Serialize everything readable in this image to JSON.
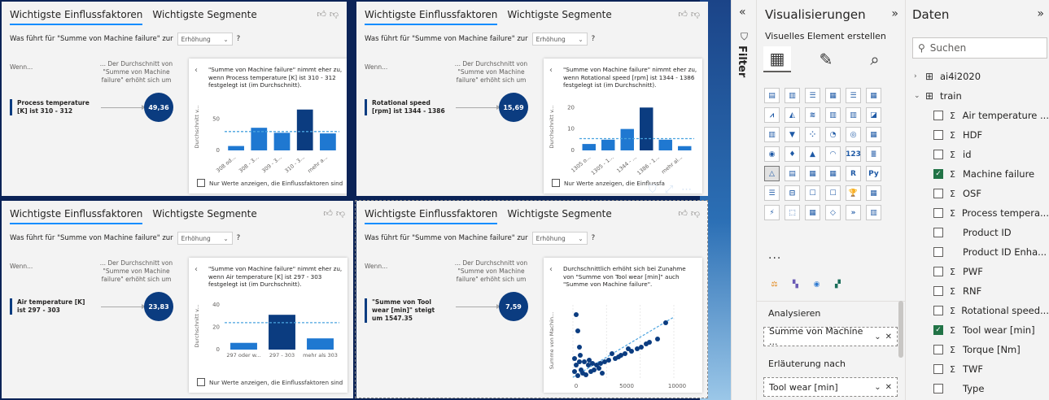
{
  "visuals": [
    {
      "tab_active": "Wichtigste Einflussfaktoren",
      "tab_other": "Wichtigste Segmente",
      "question_prefix": "Was führt für \"Summe von Machine failure\" zur",
      "select_value": "Erhöhung",
      "question_mark": "?",
      "wenn": "Wenn...",
      "avg_text": "... Der Durchschnitt von \"Summe von Machine failure\" erhöht sich um",
      "factor": "Process temperature [K] ist 310 - 312",
      "value": "49,36",
      "card_text": "\"Summe von Machine failure\" nimmt eher zu, wenn Process temperature [K] ist 310 - 312 festgelegt ist (im Durchschnitt).",
      "checkbox": "Nur Werte anzeigen, die Einflussfaktoren sind",
      "chart": {
        "ylabel": "Durchschnitt v...",
        "yticks": [
          "0",
          "50"
        ],
        "categories": [
          "308 od...",
          "308 - 3...",
          "309 - 3...",
          "310 - 3...",
          "mehr a..."
        ],
        "values": [
          7,
          36,
          28,
          65,
          27
        ],
        "highlight": 3,
        "avg": 30,
        "ymax": 75
      }
    },
    {
      "tab_active": "Wichtigste Einflussfaktoren",
      "tab_other": "Wichtigste Segmente",
      "question_prefix": "Was führt für \"Summe von Machine failure\" zur",
      "select_value": "Erhöhung",
      "question_mark": "?",
      "wenn": "Wenn...",
      "avg_text": "... Der Durchschnitt von \"Summe von Machine failure\" erhöht sich um",
      "factor": "Rotational speed [rpm] ist 1344 - 1386",
      "value": "15,69",
      "card_text": "\"Summe von Machine failure\" nimmt eher zu, wenn Rotational speed [rpm] ist 1344 - 1386 festgelegt ist (im Durchschnitt).",
      "checkbox": "Nur Werte anzeigen, die Einflussfa",
      "chart": {
        "ylabel": "Durchschnitt v...",
        "yticks": [
          "0",
          "10",
          "20"
        ],
        "categories": [
          "1305 o...",
          "1305 - 1...",
          "1344 - ...",
          "1386 - 1...",
          "mehr al..."
        ],
        "values": [
          3,
          5,
          10,
          20,
          5,
          2
        ],
        "highlight": 3,
        "avg": 5.5,
        "ymax": 22
      }
    },
    {
      "tab_active": "Wichtigste Einflussfaktoren",
      "tab_other": "Wichtigste Segmente",
      "question_prefix": "Was führt für \"Summe von Machine failure\" zur",
      "select_value": "Erhöhung",
      "question_mark": "?",
      "wenn": "Wenn...",
      "avg_text": "... Der Durchschnitt von \"Summe von Machine failure\" erhöht sich um",
      "factor": "Air temperature [K] ist 297 - 303",
      "value": "23,83",
      "card_text": "\"Summe von Machine failure\" nimmt eher zu, wenn Air temperature [K] ist 297 - 303 festgelegt ist (im Durchschnitt).",
      "checkbox": "Nur Werte anzeigen, die Einflussfaktoren sind",
      "chart": {
        "ylabel": "Durchschnitt v...",
        "yticks": [
          "0",
          "20",
          "40"
        ],
        "categories": [
          "297 oder w...",
          "297 - 303",
          "mehr als 303"
        ],
        "values": [
          6,
          31,
          10
        ],
        "highlight": 1,
        "avg": 24,
        "ymax": 42
      }
    },
    {
      "tab_active": "Wichtigste Einflussfaktoren",
      "tab_other": "Wichtigste Segmente",
      "question_prefix": "Was führt für \"Summe von Machine failure\" zur",
      "select_value": "Erhöhung",
      "question_mark": "?",
      "wenn": "Wenn...",
      "avg_text": "... Der Durchschnitt von \"Summe von Machine failure\" erhöht sich um",
      "factor": "\"Summe von Tool wear [min]\" steigt um 1547.35",
      "value": "7,59",
      "card_text": "Durchschnittlich erhöht sich bei Zunahme von \"Summe von Tool wear [min]\" auch \"Summe von Machine failure\".",
      "checkbox": "",
      "chart": {
        "ylabel": "Summe von Machin...",
        "xticks": [
          "0",
          "5000",
          "10000"
        ]
      }
    }
  ],
  "filter": {
    "label": "Filter"
  },
  "viz_pane": {
    "title": "Visualisierungen",
    "subtitle": "Visuelles Element erstellen",
    "more": "...",
    "analyze_label": "Analysieren",
    "analyze_field": "Summe von Machine ...",
    "explain_label": "Erläuterung nach",
    "explain_field": "Tool wear [min]"
  },
  "data_pane": {
    "title": "Daten",
    "search_placeholder": "Suchen",
    "tables": [
      {
        "name": "ai4i2020",
        "expanded": false
      },
      {
        "name": "train",
        "expanded": true
      }
    ],
    "fields": [
      {
        "name": "Air temperature ...",
        "sigma": true,
        "checked": false
      },
      {
        "name": "HDF",
        "sigma": true,
        "checked": false
      },
      {
        "name": "id",
        "sigma": true,
        "checked": false
      },
      {
        "name": "Machine failure",
        "sigma": true,
        "checked": true
      },
      {
        "name": "OSF",
        "sigma": true,
        "checked": false
      },
      {
        "name": "Process tempera...",
        "sigma": true,
        "checked": false
      },
      {
        "name": "Product ID",
        "sigma": false,
        "checked": false
      },
      {
        "name": "Product ID Enha...",
        "sigma": false,
        "checked": false
      },
      {
        "name": "PWF",
        "sigma": true,
        "checked": false
      },
      {
        "name": "RNF",
        "sigma": true,
        "checked": false
      },
      {
        "name": "Rotational speed...",
        "sigma": true,
        "checked": false
      },
      {
        "name": "Tool wear [min]",
        "sigma": true,
        "checked": true
      },
      {
        "name": "Torque [Nm]",
        "sigma": true,
        "checked": false
      },
      {
        "name": "TWF",
        "sigma": true,
        "checked": false
      },
      {
        "name": "Type",
        "sigma": false,
        "checked": false
      }
    ]
  },
  "colors": {
    "bar": "#1f78d1",
    "highlight": "#0b3c80",
    "avg_line": "#4aa3df",
    "accent": "#118dff"
  }
}
